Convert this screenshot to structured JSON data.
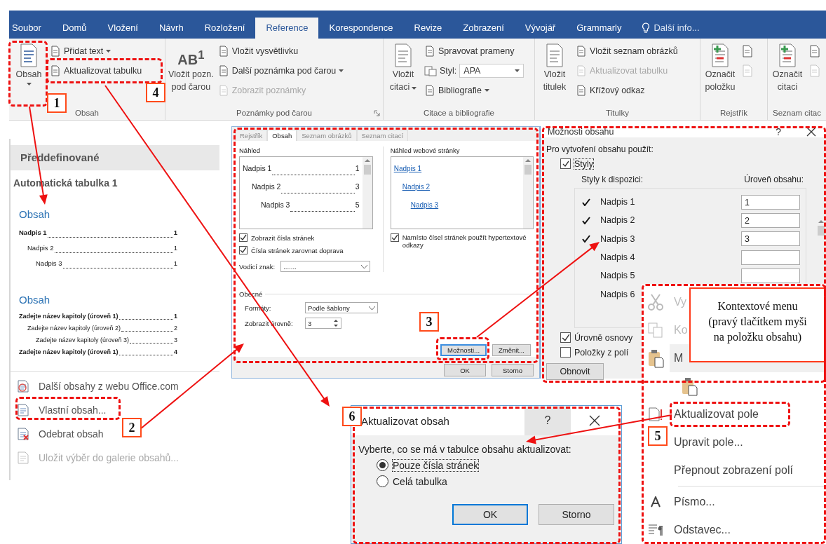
{
  "ribbon": {
    "tabs": [
      {
        "label": "Soubor",
        "selected": false
      },
      {
        "label": "Domů",
        "selected": false
      },
      {
        "label": "Vložení",
        "selected": false
      },
      {
        "label": "Návrh",
        "selected": false
      },
      {
        "label": "Rozložení",
        "selected": false
      },
      {
        "label": "Reference",
        "selected": true
      },
      {
        "label": "Korespondence",
        "selected": false
      },
      {
        "label": "Revize",
        "selected": false
      },
      {
        "label": "Zobrazení",
        "selected": false
      },
      {
        "label": "Vývojář",
        "selected": false
      },
      {
        "label": "Grammarly",
        "selected": false
      }
    ],
    "tell_me": "Další info...",
    "groups": [
      {
        "label": "Obsah",
        "launcher": false,
        "columns": [
          {
            "kind": "big",
            "lines": [
              "Obsah"
            ],
            "dropdown": true
          },
          {
            "kind": "stack",
            "items": [
              {
                "label": "Přidat text",
                "dropdown": true,
                "disabled": false
              },
              {
                "label": "Aktualizovat tabulku",
                "dropdown": false,
                "disabled": false
              }
            ]
          }
        ]
      },
      {
        "label": "Poznámky pod čarou",
        "launcher": true,
        "columns": [
          {
            "kind": "big",
            "glyph": "AB$^{1}$",
            "lines": [
              "Vložit pozn.",
              "pod čarou"
            ],
            "dropdown": false
          },
          {
            "kind": "stack",
            "items": [
              {
                "label": "Vložit vysvětlivku",
                "dropdown": false,
                "disabled": false
              },
              {
                "label": "Další poznámka pod čarou",
                "dropdown": true,
                "disabled": false
              },
              {
                "label": "Zobrazit poznámky",
                "dropdown": false,
                "disabled": true
              }
            ]
          }
        ]
      },
      {
        "label": "Citace a bibliografie",
        "launcher": false,
        "columns": [
          {
            "kind": "big",
            "lines": [
              "Vložit",
              "citaci"
            ],
            "dropdown": true
          },
          {
            "kind": "stack",
            "items": [
              {
                "label": "Spravovat prameny",
                "dropdown": false,
                "disabled": false
              },
              {
                "label": "Styl:",
                "value": "APA",
                "dropdown": true
              },
              {
                "label": "Bibliografie",
                "dropdown": true,
                "disabled": false
              }
            ]
          }
        ]
      },
      {
        "label": "Titulky",
        "launcher": false,
        "columns": [
          {
            "kind": "big",
            "lines": [
              "Vložit",
              "titulek"
            ],
            "dropdown": false
          },
          {
            "kind": "stack",
            "items": [
              {
                "label": "Vložit seznam obrázků",
                "dropdown": false,
                "disabled": false
              },
              {
                "label": "Aktualizovat tabulku",
                "dropdown": false,
                "disabled": true
              },
              {
                "label": "Křížový odkaz",
                "dropdown": false,
                "disabled": false
              }
            ]
          }
        ]
      },
      {
        "label": "Rejstřík",
        "launcher": false,
        "columns": [
          {
            "kind": "big",
            "lines": [
              "Označit",
              "položku"
            ],
            "dropdown": false
          },
          {
            "kind": "stack",
            "items": [
              {
                "disabled": false
              },
              {
                "disabled": true
              }
            ]
          }
        ]
      },
      {
        "label": "Seznam citac",
        "launcher": false,
        "columns": [
          {
            "kind": "big",
            "lines": [
              "Označit",
              "citaci"
            ],
            "dropdown": false
          },
          {
            "kind": "stack",
            "items": [
              {
                "disabled": false
              },
              {
                "disabled": true
              }
            ]
          }
        ]
      }
    ]
  },
  "gallery": {
    "header": "Předdefinované",
    "subtitle": "Automatická tabulka 1",
    "previews": [
      {
        "title": "Obsah",
        "entries": [
          {
            "text": "Nadpis 1",
            "page": "1",
            "children": [
              {
                "text": "Nadpis 2",
                "page": "1",
                "children": [
                  {
                    "text": "Nadpis 3",
                    "page": "1"
                  }
                ]
              }
            ]
          }
        ]
      },
      {
        "title": "Obsah",
        "entries": [
          {
            "text": "Zadejte název kapitoly (úroveň 1)",
            "page": "1",
            "children": [
              {
                "text": "Zadejte název kapitoly (úroveň 2)",
                "page": "2",
                "children": [
                  {
                    "text": "Zadejte název kapitoly (úroveň 3)",
                    "page": "3"
                  }
                ]
              }
            ]
          },
          {
            "text": "Zadejte název kapitoly (úroveň 1)",
            "page": "4"
          }
        ]
      }
    ],
    "menu": [
      {
        "label": "Další obsahy z webu Office.com",
        "disabled": false
      },
      {
        "label": "Vlastní obsah...",
        "disabled": false
      },
      {
        "label": "Odebrat obsah",
        "disabled": false
      },
      {
        "label": "Uložit výběr do galerie obsahů...",
        "disabled": true
      }
    ]
  },
  "toc_dialog": {
    "tabs": [
      {
        "label": "Rejstřík",
        "selected": false
      },
      {
        "label": "Obsah",
        "selected": true
      },
      {
        "label": "Seznam obrázků",
        "selected": false
      },
      {
        "label": "Seznam citací",
        "selected": false
      }
    ],
    "preview_label": "Náhled",
    "preview": [
      {
        "text": "Nadpis 1",
        "page": "1",
        "children": [
          {
            "text": "Nadpis 2",
            "page": "3",
            "children": [
              {
                "text": "Nadpis 3",
                "page": "5"
              }
            ]
          }
        ]
      }
    ],
    "web_label": "Náhled webové stránky",
    "web_preview": [
      {
        "text": "Nadpis 1",
        "children": [
          {
            "text": "Nadpis 2",
            "children": [
              {
                "text": "Nadpis 3"
              }
            ]
          }
        ]
      }
    ],
    "left_checks": [
      {
        "label": "Zobrazit čísla stránek",
        "checked": true
      },
      {
        "label": "Čísla stránek zarovnat doprava",
        "checked": true
      }
    ],
    "right_check": {
      "label": "Namísto čísel stránek použít hypertextové odkazy",
      "checked": true
    },
    "leader": {
      "label": "Vodicí znak:",
      "value": "......."
    },
    "general_label": "Obecné",
    "formats": {
      "label": "Formáty:",
      "value": "Podle šablony"
    },
    "levels": {
      "label": "Zobrazit úrovně:",
      "value": "3"
    },
    "options_button": "Možnosti...",
    "modify_button": "Změnit...",
    "ok": "OK",
    "cancel": "Storno"
  },
  "options_dialog": {
    "title": "Možnosti obsahu",
    "help": "?",
    "prompt": "Pro vytvoření obsahu použít:",
    "styles_check": {
      "label": "Styly",
      "checked": true
    },
    "available_label": "Styly k dispozici:",
    "level_label": "Úroveň obsahu:",
    "styles": [
      {
        "name": "Nadpis 1",
        "checked": true,
        "level": "1"
      },
      {
        "name": "Nadpis 2",
        "checked": true,
        "level": "2"
      },
      {
        "name": "Nadpis 3",
        "checked": true,
        "level": "3"
      },
      {
        "name": "Nadpis 4",
        "checked": false
      },
      {
        "name": "Nadpis 5",
        "checked": false
      },
      {
        "name": "Nadpis 6",
        "checked": false
      }
    ],
    "checks": [
      {
        "label": "Úrovně osnovy",
        "checked": true
      },
      {
        "label": "Položky z polí",
        "checked": false
      }
    ],
    "reset": "Obnovit"
  },
  "context_menu": {
    "items": [
      {
        "kind": "cut",
        "label": "Vy",
        "disabled": true,
        "selected": false
      },
      {
        "kind": "copy",
        "label": "Ko",
        "disabled": true,
        "selected": false
      },
      {
        "kind": "paste",
        "label": "M",
        "disabled": false,
        "selected": true
      },
      {
        "kind": "paste-option"
      },
      {
        "kind": "update",
        "label": "Aktualizovat pole",
        "disabled": false,
        "selected": false
      },
      {
        "kind": "text",
        "label": "Upravit pole...",
        "disabled": false,
        "selected": false
      },
      {
        "kind": "text",
        "label": "Přepnout zobrazení polí",
        "disabled": false,
        "selected": false
      },
      {
        "kind": "separator"
      },
      {
        "kind": "font",
        "label": "Písmo...",
        "disabled": false,
        "selected": false
      },
      {
        "kind": "paragraph",
        "label": "Odstavec...",
        "disabled": false,
        "selected": false
      }
    ]
  },
  "callout_note": "Kontextové menu\n(pravý tlačítkem myši\nna položku obsahu)",
  "update_dialog": {
    "title": "Aktualizovat obsah",
    "help": "?",
    "prompt": "Vyberte, co se má v tabulce obsahu aktualizovat:",
    "options": [
      {
        "label": "Pouze čísla stránek",
        "selected": true
      },
      {
        "label": "Celá tabulka",
        "selected": false
      }
    ],
    "ok": "OK",
    "cancel": "Storno"
  },
  "step_badges": [
    "1",
    "2",
    "3",
    "4",
    "5",
    "6"
  ]
}
